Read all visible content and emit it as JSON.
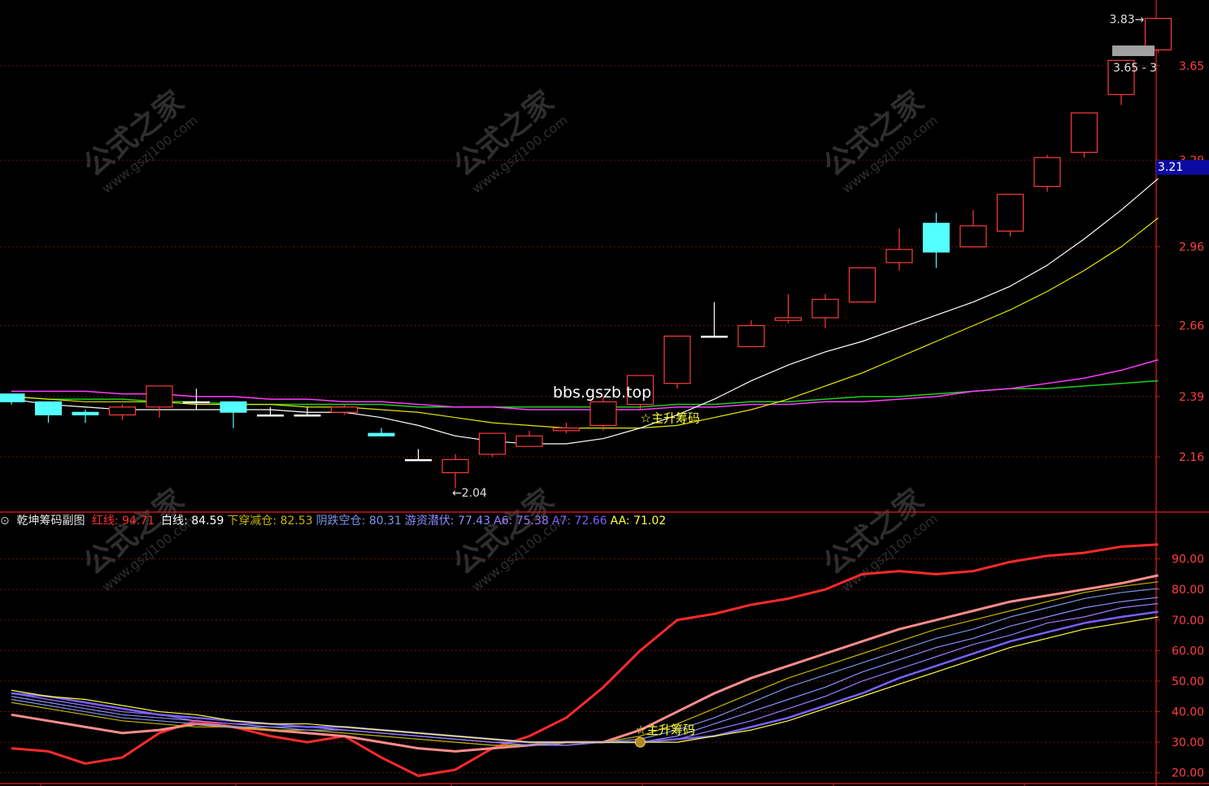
{
  "watermark": {
    "main": "公式之家",
    "url": "www.gszj100.com"
  },
  "overlay_text": "bbs.gszb.top",
  "colors": {
    "up": "#ff3b3b",
    "down": "#54ffff",
    "white_ma": "#ffffff",
    "yellow_ma": "#e6e600",
    "magenta_ma": "#ff3bff",
    "green_ma": "#19d219",
    "axis": "#c01818",
    "axis_text": "#ff4040"
  },
  "chart_data": [
    {
      "type": "candlestick",
      "title": "",
      "ylim": [
        1.95,
        3.9
      ],
      "y_ticks": [
        "2.16",
        "2.39",
        "2.66",
        "2.96",
        "3.29",
        "3.65"
      ],
      "last_price_label": "3.21",
      "high_label": "3.83",
      "price_box_label": "3.65 - 3",
      "low_label": "2.04",
      "signal_label": "主升筹码",
      "candles": [
        {
          "o": 2.4,
          "c": 2.37,
          "h": 2.4,
          "l": 2.36
        },
        {
          "o": 2.37,
          "c": 2.32,
          "h": 2.37,
          "l": 2.29
        },
        {
          "o": 2.33,
          "c": 2.32,
          "h": 2.34,
          "l": 2.29
        },
        {
          "o": 2.32,
          "c": 2.35,
          "h": 2.36,
          "l": 2.3
        },
        {
          "o": 2.35,
          "c": 2.43,
          "h": 2.43,
          "l": 2.31
        },
        {
          "o": 2.37,
          "c": 2.37,
          "h": 2.42,
          "l": 2.34
        },
        {
          "o": 2.37,
          "c": 2.33,
          "h": 2.37,
          "l": 2.27
        },
        {
          "o": 2.32,
          "c": 2.32,
          "h": 2.35,
          "l": 2.32
        },
        {
          "o": 2.32,
          "c": 2.32,
          "h": 2.35,
          "l": 2.32
        },
        {
          "o": 2.33,
          "c": 2.35,
          "h": 2.36,
          "l": 2.32
        },
        {
          "o": 2.25,
          "c": 2.24,
          "h": 2.27,
          "l": 2.24
        },
        {
          "o": 2.15,
          "c": 2.15,
          "h": 2.19,
          "l": 2.15
        },
        {
          "o": 2.1,
          "c": 2.15,
          "h": 2.17,
          "l": 2.04
        },
        {
          "o": 2.17,
          "c": 2.25,
          "h": 2.25,
          "l": 2.16
        },
        {
          "o": 2.2,
          "c": 2.24,
          "h": 2.26,
          "l": 2.2
        },
        {
          "o": 2.26,
          "c": 2.27,
          "h": 2.29,
          "l": 2.25
        },
        {
          "o": 2.28,
          "c": 2.37,
          "h": 2.39,
          "l": 2.26
        },
        {
          "o": 2.36,
          "c": 2.47,
          "h": 2.47,
          "l": 2.34
        },
        {
          "o": 2.44,
          "c": 2.62,
          "h": 2.62,
          "l": 2.42
        },
        {
          "o": 2.62,
          "c": 2.62,
          "h": 2.75,
          "l": 2.62
        },
        {
          "o": 2.58,
          "c": 2.66,
          "h": 2.68,
          "l": 2.58
        },
        {
          "o": 2.68,
          "c": 2.69,
          "h": 2.78,
          "l": 2.67
        },
        {
          "o": 2.69,
          "c": 2.76,
          "h": 2.78,
          "l": 2.65
        },
        {
          "o": 2.75,
          "c": 2.88,
          "h": 2.88,
          "l": 2.75
        },
        {
          "o": 2.9,
          "c": 2.95,
          "h": 3.03,
          "l": 2.87
        },
        {
          "o": 3.05,
          "c": 2.94,
          "h": 3.09,
          "l": 2.88
        },
        {
          "o": 2.96,
          "c": 3.04,
          "h": 3.1,
          "l": 2.96
        },
        {
          "o": 3.02,
          "c": 3.16,
          "h": 3.16,
          "l": 3.0
        },
        {
          "o": 3.19,
          "c": 3.3,
          "h": 3.31,
          "l": 3.17
        },
        {
          "o": 3.32,
          "c": 3.47,
          "h": 3.47,
          "l": 3.3
        },
        {
          "o": 3.54,
          "c": 3.67,
          "h": 3.67,
          "l": 3.5
        },
        {
          "o": 3.71,
          "c": 3.83,
          "h": 3.83,
          "l": 3.7
        }
      ],
      "ma_white": [
        2.38,
        2.36,
        2.35,
        2.34,
        2.34,
        2.34,
        2.34,
        2.34,
        2.33,
        2.33,
        2.31,
        2.28,
        2.24,
        2.22,
        2.21,
        2.21,
        2.23,
        2.27,
        2.32,
        2.38,
        2.45,
        2.51,
        2.56,
        2.6,
        2.65,
        2.7,
        2.75,
        2.81,
        2.89,
        2.99,
        3.1,
        3.22
      ],
      "ma_yellow": [
        2.39,
        2.38,
        2.37,
        2.37,
        2.37,
        2.36,
        2.36,
        2.36,
        2.35,
        2.35,
        2.34,
        2.33,
        2.31,
        2.29,
        2.28,
        2.27,
        2.27,
        2.27,
        2.28,
        2.31,
        2.34,
        2.38,
        2.43,
        2.48,
        2.54,
        2.6,
        2.66,
        2.72,
        2.79,
        2.87,
        2.96,
        3.07
      ],
      "ma_magenta": [
        2.41,
        2.41,
        2.41,
        2.4,
        2.4,
        2.39,
        2.39,
        2.38,
        2.38,
        2.37,
        2.37,
        2.36,
        2.35,
        2.35,
        2.34,
        2.34,
        2.34,
        2.34,
        2.35,
        2.35,
        2.36,
        2.36,
        2.37,
        2.37,
        2.38,
        2.39,
        2.41,
        2.42,
        2.44,
        2.46,
        2.49,
        2.53
      ],
      "ma_green": [
        2.39,
        2.38,
        2.38,
        2.38,
        2.37,
        2.37,
        2.36,
        2.36,
        2.36,
        2.36,
        2.36,
        2.35,
        2.35,
        2.35,
        2.35,
        2.35,
        2.35,
        2.35,
        2.36,
        2.36,
        2.37,
        2.37,
        2.38,
        2.39,
        2.39,
        2.4,
        2.41,
        2.42,
        2.42,
        2.43,
        2.44,
        2.45
      ]
    },
    {
      "type": "line",
      "title": "乾坤筹码副图",
      "ylim": [
        17,
        100
      ],
      "y_ticks": [
        "20.00",
        "30.00",
        "40.00",
        "50.00",
        "60.00",
        "70.00",
        "80.00",
        "90.00"
      ],
      "signal_label": "主升筹码",
      "x": [
        0,
        1,
        2,
        3,
        4,
        5,
        6,
        7,
        8,
        9,
        10,
        11,
        12,
        13,
        14,
        15,
        16,
        17,
        18,
        19,
        20,
        21,
        22,
        23,
        24,
        25,
        26,
        27,
        28,
        29,
        30,
        31
      ],
      "series": [
        {
          "name": "红线",
          "value_label": "94.71",
          "color": "#ff2a2a",
          "width": 3,
          "values": [
            28,
            27,
            23,
            25,
            33,
            37,
            35,
            32,
            30,
            32,
            25,
            19,
            21,
            28,
            32,
            38,
            48,
            60,
            70,
            72,
            75,
            77,
            80,
            85,
            86,
            85,
            86,
            89,
            91,
            92,
            94,
            94.7
          ]
        },
        {
          "name": "白线",
          "value_label": "84.59",
          "color": "#ff8c8c",
          "width": 3,
          "values": [
            39,
            37,
            35,
            33,
            34,
            36,
            35,
            34,
            33,
            32,
            30,
            28,
            27,
            28,
            29,
            30,
            30,
            34,
            40,
            46,
            51,
            55,
            59,
            63,
            67,
            70,
            73,
            76,
            78,
            80,
            82,
            84.6
          ]
        },
        {
          "name": "下穿减仓",
          "value_label": "82.53",
          "color": "#c8b400",
          "width": 1.2,
          "values": [
            43,
            41,
            39,
            37,
            36,
            35,
            35,
            34,
            34,
            33,
            32,
            31,
            30,
            29,
            29,
            30,
            30,
            32,
            36,
            41,
            46,
            51,
            55,
            59,
            63,
            67,
            70,
            73,
            76,
            79,
            81,
            82.5
          ]
        },
        {
          "name": "阴跌空仓",
          "value_label": "80.31",
          "color": "#7896e6",
          "width": 1.2,
          "values": [
            44,
            42,
            40,
            38,
            37,
            36,
            35,
            35,
            34,
            34,
            33,
            32,
            31,
            30,
            29,
            29,
            30,
            31,
            34,
            38,
            43,
            48,
            52,
            56,
            60,
            64,
            67,
            71,
            74,
            77,
            79,
            80.3
          ]
        },
        {
          "name": "游资潜伏",
          "value_label": "77.43",
          "color": "#8c8cff",
          "width": 1.2,
          "values": [
            45,
            43,
            41,
            39,
            38,
            37,
            36,
            35,
            35,
            34,
            33,
            32,
            31,
            30,
            29,
            29,
            30,
            30,
            32,
            36,
            40,
            44,
            48,
            53,
            57,
            61,
            64,
            68,
            71,
            74,
            76,
            77.4
          ]
        },
        {
          "name": "A6",
          "value_label": "75.38",
          "color": "#9a78ff",
          "width": 1.2,
          "values": [
            46,
            44,
            42,
            40,
            39,
            37,
            36,
            36,
            35,
            34,
            33,
            32,
            31,
            30,
            30,
            29,
            30,
            30,
            31,
            34,
            37,
            41,
            45,
            50,
            54,
            58,
            62,
            65,
            69,
            71,
            74,
            75.4
          ]
        },
        {
          "name": "A7",
          "value_label": "72.66",
          "color": "#7860ff",
          "width": 2.5,
          "values": [
            46,
            45,
            43,
            41,
            39,
            38,
            37,
            36,
            35,
            35,
            34,
            33,
            32,
            31,
            30,
            30,
            30,
            30,
            31,
            32,
            35,
            38,
            42,
            46,
            51,
            55,
            59,
            63,
            66,
            69,
            71,
            72.7
          ]
        },
        {
          "name": "AA",
          "value_label": "71.02",
          "color": "#ffff3c",
          "width": 1.2,
          "values": [
            47,
            45,
            44,
            42,
            40,
            39,
            37,
            36,
            36,
            35,
            34,
            33,
            32,
            31,
            30,
            30,
            30,
            30,
            30,
            32,
            34,
            37,
            41,
            45,
            49,
            53,
            57,
            61,
            64,
            67,
            69,
            71.0
          ]
        }
      ]
    }
  ]
}
